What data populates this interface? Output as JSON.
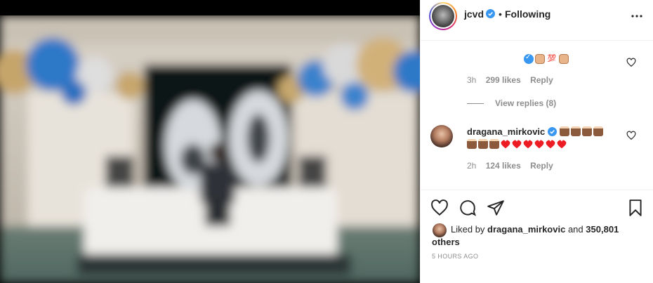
{
  "post": {
    "author": "jcvd",
    "follow_status": "Following",
    "separator": "•"
  },
  "comments": [
    {
      "emojis": [
        "verified-check",
        "fist",
        "hundred",
        "fist"
      ],
      "age": "3h",
      "likes": "299 likes",
      "reply": "Reply",
      "view_replies": "View replies (8)"
    },
    {
      "username": "dragana_mirkovic",
      "emojis_line1": [
        "cake",
        "cake",
        "cake",
        "cake"
      ],
      "emojis_line2": [
        "cake",
        "cake",
        "cake",
        "heart",
        "heart",
        "heart",
        "heart",
        "heart",
        "heart"
      ],
      "age": "2h",
      "likes": "124 likes",
      "reply": "Reply"
    }
  ],
  "actions": {
    "icons": [
      "heart-icon",
      "comment-icon",
      "share-icon",
      "bookmark-icon"
    ]
  },
  "likes_summary": {
    "prefix": "Liked by",
    "user": "dragana_mirkovic",
    "connector": "and",
    "others": "350,801 others"
  },
  "timestamp": "5 HOURS AGO",
  "colors": {
    "verified": "#3897f0",
    "heart_red": "#ed4956",
    "muted": "#8e8e8e",
    "text": "#262626"
  }
}
